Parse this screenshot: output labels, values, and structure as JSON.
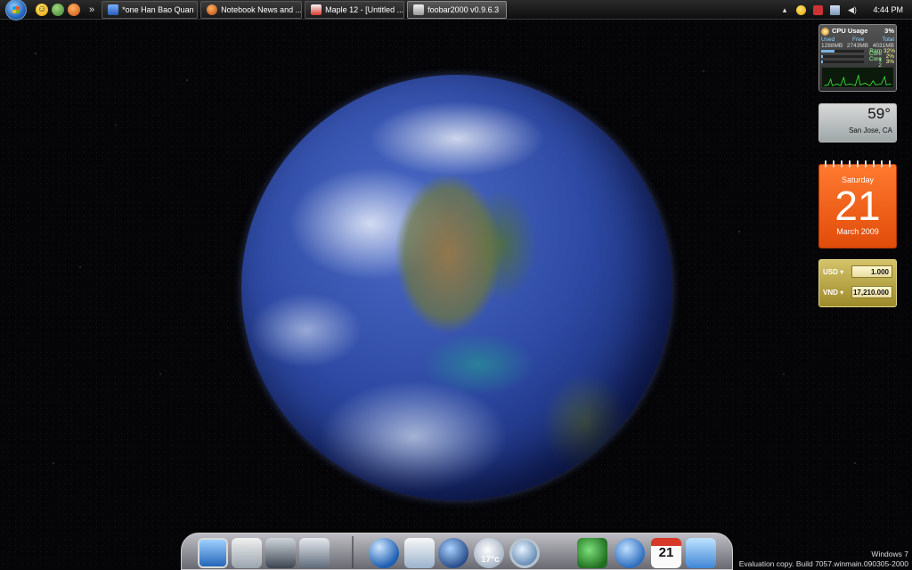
{
  "taskbar": {
    "quick_launch_icons": [
      "smiley-icon",
      "contacts-icon",
      "firefox-icon"
    ],
    "overflow_glyph": "»",
    "tasks": [
      {
        "label": "*one Han Bao Quan ...",
        "icon": "messenger-icon",
        "active": false
      },
      {
        "label": "Notebook News and ...",
        "icon": "firefox-icon",
        "active": false
      },
      {
        "label": "Maple 12  - [Untitled ...",
        "icon": "maple-icon",
        "active": false
      },
      {
        "label": "foobar2000 v0.9.6.3",
        "icon": "foobar-icon",
        "active": true
      }
    ],
    "tray": {
      "expand_glyph": "▴",
      "clock": "4:44 PM"
    }
  },
  "gadgets": {
    "cpu": {
      "title": "CPU Usage",
      "total_pct": "3%",
      "headers": [
        "Used",
        "Free",
        "Total"
      ],
      "values": [
        "1288MB",
        "2743MB",
        "4031MB"
      ],
      "rows": [
        {
          "label": "Ram",
          "pct": "32%",
          "fill": 0.32
        },
        {
          "label": "Core 1",
          "pct": "2%",
          "fill": 0.02
        },
        {
          "label": "Core 2",
          "pct": "3%",
          "fill": 0.03
        }
      ]
    },
    "weather": {
      "temp": "59°",
      "city": "San Jose, CA"
    },
    "calendar": {
      "weekday": "Saturday",
      "day": "21",
      "month_year": "March 2009"
    },
    "currency": {
      "rows": [
        {
          "code": "USD ▾",
          "value": "1.000"
        },
        {
          "code": "VND ▾",
          "value": "17,210.000"
        }
      ]
    }
  },
  "dock": {
    "weather_temp": "17°c",
    "calendar_day": "21",
    "icons": [
      "monitor-icon",
      "documents-icon",
      "computer-icon",
      "music-icon",
      "network-globe-icon",
      "mail-icon",
      "media-player-icon",
      "weather-icon",
      "search-icon",
      "green-dragon-icon",
      "settings-icon",
      "calendar-icon",
      "finder-icon"
    ]
  },
  "watermark": {
    "line1": "Windows 7",
    "line2": "Evaluation copy. Build 7057.winmain.090305-2000"
  }
}
